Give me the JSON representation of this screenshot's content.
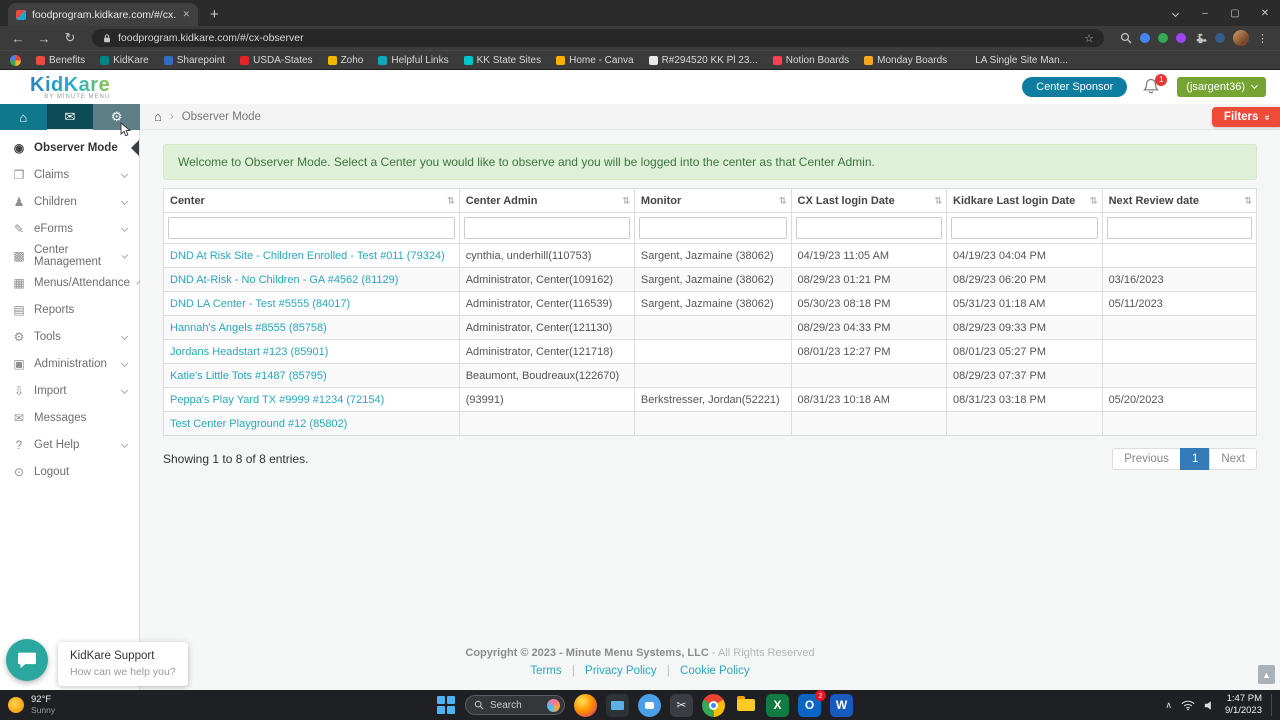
{
  "browser": {
    "tab": {
      "title": "foodprogram.kidkare.com/#/cx..."
    },
    "url": "foodprogram.kidkare.com/#/cx-observer",
    "bookmarks": [
      {
        "label": "Benefits"
      },
      {
        "label": "KidKare"
      },
      {
        "label": "Sharepoint"
      },
      {
        "label": "USDA-States"
      },
      {
        "label": "Zoho"
      },
      {
        "label": "Helpful Links"
      },
      {
        "label": "KK State Sites"
      },
      {
        "label": "Home - Canva"
      },
      {
        "label": "R#294520 KK Pl 23..."
      },
      {
        "label": "Notion Boards"
      },
      {
        "label": "Monday Boards"
      },
      {
        "label": "LA Single Site Man..."
      }
    ]
  },
  "app": {
    "logo": "KidKare",
    "logo_tagline": "BY MINUTE MENU",
    "center_sponsor": "Center Sponsor",
    "notifications": "1",
    "user": "(jsargent36)",
    "breadcrumb": "Observer Mode",
    "filters": "Filters"
  },
  "sidebar": {
    "items": [
      {
        "label": "Observer Mode",
        "active": true
      },
      {
        "label": "Claims",
        "expandable": true
      },
      {
        "label": "Children",
        "expandable": true
      },
      {
        "label": "eForms",
        "expandable": true
      },
      {
        "label": "Center Management",
        "expandable": true
      },
      {
        "label": "Menus/Attendance",
        "expandable": true
      },
      {
        "label": "Reports"
      },
      {
        "label": "Tools",
        "expandable": true
      },
      {
        "label": "Administration",
        "expandable": true
      },
      {
        "label": "Import",
        "expandable": true
      },
      {
        "label": "Messages"
      },
      {
        "label": "Get Help",
        "expandable": true
      },
      {
        "label": "Logout"
      }
    ]
  },
  "main": {
    "welcome": "Welcome to Observer Mode. Select a Center you would like to observe and you will be logged into the center as that Center Admin.",
    "table": {
      "columns": [
        "Center",
        "Center Admin",
        "Monitor",
        "CX Last login Date",
        "Kidkare Last login Date",
        "Next Review date"
      ],
      "rows": [
        {
          "center": "DND At Risk Site - Children Enrolled - Test #011 (79324)",
          "center_admin": "cynthia, underhill(110753)",
          "monitor": "Sargent, Jazmaine (38062)",
          "cx_last_login": "04/19/23 11:05 AM",
          "kidkare_last_login": "04/19/23 04:04 PM",
          "next_review": ""
        },
        {
          "center": "DND At-Risk - No Children - GA #4562 (81129)",
          "center_admin": "Administrator, Center(109162)",
          "monitor": "Sargent, Jazmaine (38062)",
          "cx_last_login": "08/29/23 01:21 PM",
          "kidkare_last_login": "08/29/23 06:20 PM",
          "next_review": "03/16/2023"
        },
        {
          "center": "DND LA Center - Test #5555 (84017)",
          "center_admin": "Administrator, Center(116539)",
          "monitor": "Sargent, Jazmaine (38062)",
          "cx_last_login": "05/30/23 08:18 PM",
          "kidkare_last_login": "05/31/23 01:18 AM",
          "next_review": "05/11/2023"
        },
        {
          "center": "Hannah's Angels #8555 (85758)",
          "center_admin": "Administrator, Center(121130)",
          "monitor": "",
          "cx_last_login": "08/29/23 04:33 PM",
          "kidkare_last_login": "08/29/23 09:33 PM",
          "next_review": ""
        },
        {
          "center": "Jordans Headstart #123 (85901)",
          "center_admin": "Administrator, Center(121718)",
          "monitor": "",
          "cx_last_login": "08/01/23 12:27 PM",
          "kidkare_last_login": "08/01/23 05:27 PM",
          "next_review": ""
        },
        {
          "center": "Katie's Little Tots #1487 (85795)",
          "center_admin": "Beaumont, Boudreaux(122670)",
          "monitor": "",
          "cx_last_login": "",
          "kidkare_last_login": "08/29/23 07:37 PM",
          "next_review": ""
        },
        {
          "center": "Peppa's Play Yard TX #9999 #1234 (72154)",
          "center_admin": "(93991)",
          "monitor": "Berkstresser, Jordan(52221)",
          "cx_last_login": "08/31/23 10:18 AM",
          "kidkare_last_login": "08/31/23 03:18 PM",
          "next_review": "05/20/2023"
        },
        {
          "center": "Test Center Playground #12 (85802)",
          "center_admin": "",
          "monitor": "",
          "cx_last_login": "",
          "kidkare_last_login": "",
          "next_review": ""
        }
      ]
    },
    "showing": "Showing 1 to 8 of 8 entries.",
    "pagination": {
      "previous": "Previous",
      "page": "1",
      "next": "Next"
    }
  },
  "footer": {
    "copyright": "Copyright © 2023 - Minute Menu Systems, LLC",
    "rights": "All Rights Reserved",
    "links": [
      "Terms",
      "Privacy Policy",
      "Cookie Policy"
    ]
  },
  "chat": {
    "title": "KidKare Support",
    "subtitle": "How can we help you?"
  },
  "taskbar": {
    "weather": {
      "temp": "92°F",
      "condition": "Sunny"
    },
    "search": "Search",
    "badges": {
      "outlook": "2"
    },
    "clock": {
      "time": "1:47 PM",
      "date": "9/1/2023"
    }
  },
  "colors": {
    "brand_teal": "#26b1cc",
    "header_button": "#0d7da0",
    "user_green": "#76a433",
    "filters_red": "#ee4c38",
    "link_teal": "#2ba6bd",
    "alert_bg": "#dff0d8",
    "alert_text": "#3c763d",
    "pagination_active": "#337ab7",
    "nav_strip": "#0d4b57"
  }
}
